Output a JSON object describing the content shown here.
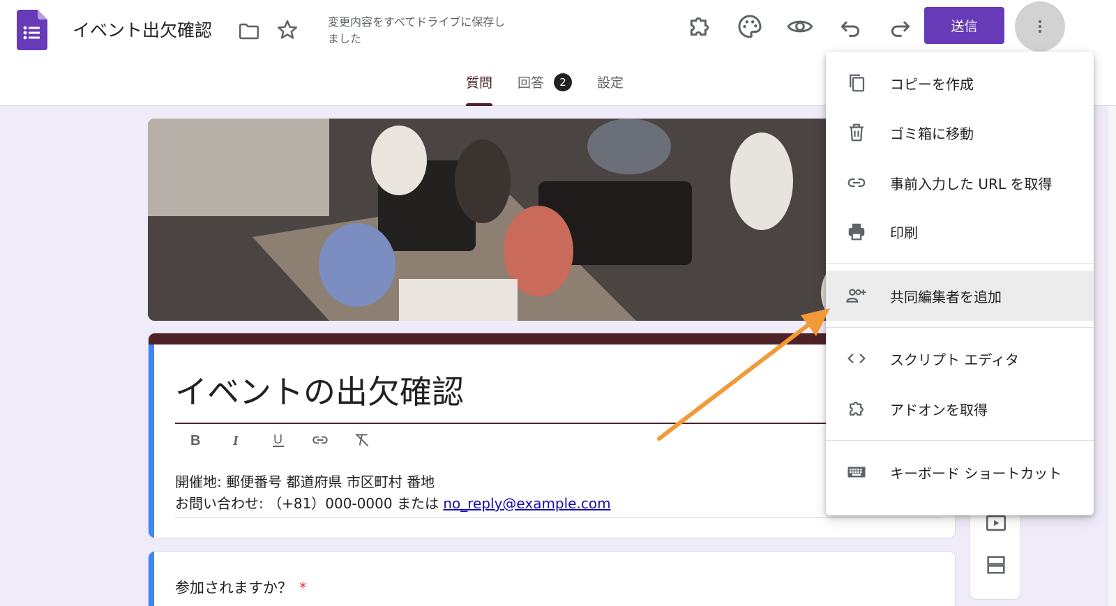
{
  "header": {
    "doc_title": "イベント出欠確認",
    "save_status": "変更内容をすべてドライブに保存しました",
    "send_label": "送信"
  },
  "tabs": [
    {
      "label": "質問",
      "active": true
    },
    {
      "label": "回答",
      "badge": "2"
    },
    {
      "label": "設定"
    }
  ],
  "form": {
    "title": "イベントの出欠確認",
    "description_line1": "開催地: 郵便番号 都道府県 市区町村 番地",
    "description_line2_prefix": "お問い合わせ: （+81）000-0000 または ",
    "description_email": "no_reply@example.com"
  },
  "question": {
    "text": "参加されますか？",
    "required_mark": "*"
  },
  "menu": {
    "items": [
      {
        "label": "コピーを作成",
        "icon": "copy-icon"
      },
      {
        "label": "ゴミ箱に移動",
        "icon": "trash-icon"
      },
      {
        "label": "事前入力した URL を取得",
        "icon": "link-icon"
      },
      {
        "label": "印刷",
        "icon": "print-icon"
      },
      {
        "label": "共同編集者を追加",
        "icon": "add-people-icon",
        "highlighted": true
      },
      {
        "label": "スクリプト エディタ",
        "icon": "code-icon"
      },
      {
        "label": "アドオンを取得",
        "icon": "addon-icon"
      },
      {
        "label": "キーボード ショートカット",
        "icon": "keyboard-icon"
      }
    ]
  },
  "colors": {
    "accent_purple": "#673ab7",
    "theme_dark": "#4e2227",
    "accent_blue": "#4285f4",
    "arrow_orange": "#f29a38"
  }
}
